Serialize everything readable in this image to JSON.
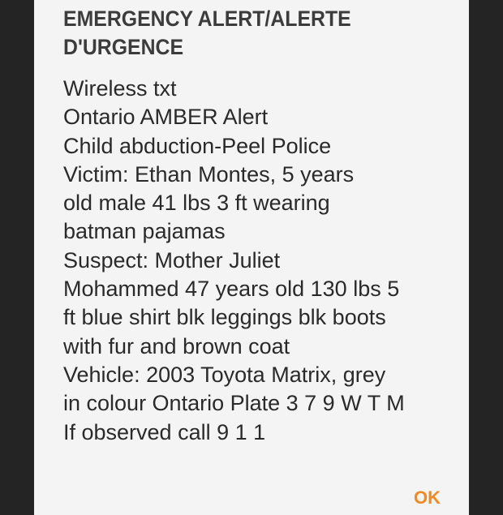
{
  "dialog": {
    "title_lines": [
      "EMERGENCY ALERT/ALERTE",
      "D'URGENCE"
    ],
    "message_lines": [
      "Wireless txt",
      "Ontario AMBER Alert",
      "Child abduction-Peel Police",
      "Victim: Ethan Montes, 5 years",
      "old male 41 lbs 3 ft wearing",
      "batman pajamas",
      "Suspect: Mother Juliet",
      "Mohammed 47 years old 130 lbs 5",
      "ft blue shirt blk leggings blk boots",
      "with fur and brown coat",
      "Vehicle: 2003 Toyota Matrix, grey",
      "in colour Ontario Plate 3 7 9 W T M",
      "If observed call 9 1 1"
    ],
    "ok_label": "OK"
  },
  "colors": {
    "background": "#242424",
    "dialog": "#f4f4f4",
    "accent": "#f08a24",
    "text": "#2a2a2a"
  }
}
